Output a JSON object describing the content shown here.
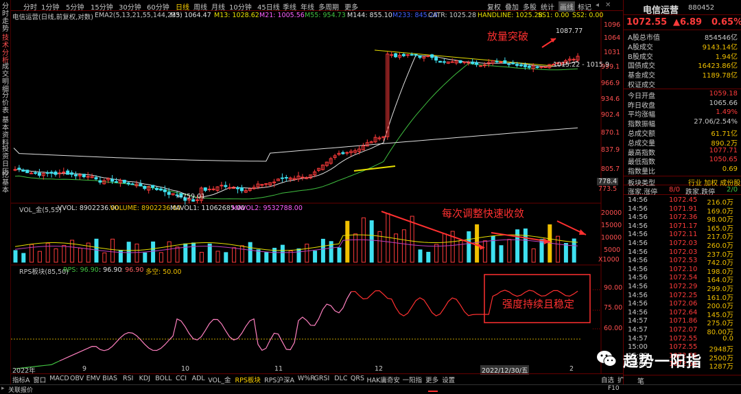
{
  "left_sidebar": [
    "分时走势",
    "技术分析",
    "成交明细",
    "分价表",
    "基本资料",
    "投资日历",
    "挖基本"
  ],
  "topbar": {
    "periods": [
      "分时",
      "1分钟",
      "5分钟",
      "15分钟",
      "30分钟",
      "60分钟",
      "日线",
      "周线",
      "月线",
      "10分钟",
      "45日线",
      "季线",
      "年线",
      "多周期",
      "更多"
    ],
    "active": "日线",
    "tools": [
      "复权",
      "叠加",
      "多股",
      "统计",
      "画线",
      "标记"
    ]
  },
  "kline_info": {
    "name": "电信运营(日线,前复权,对数)",
    "ema": "EMA2(5,13,21,55,144,233)",
    "m5": "M5: 1064.47",
    "m13": "M13: 1028.62",
    "m21": "M21: 1005.56",
    "m55": "M55: 954.73",
    "m144": "M144: 855.10",
    "m233": "M233: 845.28",
    "catr": "CATR: 1025.28",
    "handline": "HANDLINE: 1025.28",
    "ss1": "SS1: 0.00",
    "ss2": "SS2: 0.00"
  },
  "price_axis": [
    "1096",
    "1064",
    "1031",
    "999.1",
    "966.9",
    "934.6",
    "902.4",
    "870.1",
    "837.9",
    "805.7",
    "778.4",
    "773.5"
  ],
  "vol_info": {
    "name": "VOL_金(5,55)",
    "vvol": "VVOL: 8902236.00",
    "volume": "VOLUME: 8902236.00",
    "mavol1": "MAVOL1: 11062685.00",
    "mavol2": "MAVOL2: 9532788.00"
  },
  "vol_axis": [
    "20000",
    "15000",
    "10000",
    "5000",
    "X1000"
  ],
  "rps_info": {
    "name": "RPS板块(85,50)",
    "rps": "RPS: 96.90",
    "v2": ": 96.90",
    "v3": ": 96.90",
    "dk": "多空: 50.00"
  },
  "rps_axis": [
    "90.00",
    "75.00",
    "60.00"
  ],
  "x_axis": [
    "2022年",
    "9",
    "10",
    "11",
    "12",
    "2022/12/30/五",
    "2"
  ],
  "chart_labels": {
    "high": "1087.77",
    "low": "←759.01",
    "seg": "1015.22 - 1015.9"
  },
  "annotations": {
    "breakout": "放量突破",
    "converge": "每次调整快速收敛",
    "strength": "强度持续且稳定"
  },
  "rpanel": {
    "title": "电信运营",
    "code": "880452",
    "price": "1072.55",
    "change": "▲6.89",
    "pct": "0.65%",
    "rows": [
      [
        "A股总市值",
        "854546亿"
      ],
      [
        "A股成交",
        "9143.14亿"
      ],
      [
        "B股成交",
        "1.94亿"
      ],
      [
        "国债成交",
        "16423.86亿"
      ],
      [
        "基金成交",
        "1189.78亿"
      ],
      [
        "权证成交",
        ""
      ],
      [
        "今日开盘",
        "1059.18"
      ],
      [
        "昨日收盘",
        "1065.66"
      ],
      [
        "平均涨幅",
        "1.49%"
      ],
      [
        "指数振幅",
        "27.06/2.54%"
      ],
      [
        "总成交额",
        "61.71亿"
      ],
      [
        "总成交量",
        "890.2万"
      ],
      [
        "最高指数",
        "1077.71"
      ],
      [
        "最低指数",
        "1050.65"
      ],
      [
        "指数量比",
        "0.69"
      ]
    ],
    "sector_type": "板块类型",
    "sector_tags": "行业 加权 成份股",
    "zhangjia": "涨家.涨停",
    "zj_val": "8/0",
    "diejia": "跌家.跌停",
    "dj_val": "2/0",
    "ticks": [
      [
        "14:56",
        "1072.45",
        "216.0万"
      ],
      [
        "14:56",
        "1071.91",
        "169.0万"
      ],
      [
        "14:56",
        "1072.36",
        "98.00万"
      ],
      [
        "14:56",
        "1071.17",
        "165.0万"
      ],
      [
        "14:56",
        "1072.11",
        "217.0万"
      ],
      [
        "14:56",
        "1072.03",
        "260.0万"
      ],
      [
        "14:56",
        "1072.03",
        "237.0万"
      ],
      [
        "14:56",
        "1072.53",
        "742.0万"
      ],
      [
        "14:56",
        "1072.10",
        "198.0万"
      ],
      [
        "14:56",
        "1072.54",
        "164.0万"
      ],
      [
        "14:56",
        "1072.29",
        "299.0万"
      ],
      [
        "14:56",
        "1072.25",
        "161.0万"
      ],
      [
        "14:56",
        "1072.06",
        "200.0万"
      ],
      [
        "14:56",
        "1072.64",
        "145.0万"
      ],
      [
        "14:57",
        "1071.86",
        "275.0万"
      ],
      [
        "14:57",
        "1072.07",
        "80.00万"
      ],
      [
        "14:57",
        "1072.55",
        "0.0"
      ],
      [
        "15:00",
        "1072.55",
        "2948万"
      ],
      [
        "15:00",
        "1072.55",
        "2500万"
      ],
      [
        "15:00",
        "1072.55",
        "1287万"
      ]
    ]
  },
  "bottom_tabs": [
    "指标A",
    "窗口",
    "MACD",
    "OBV",
    "EMV",
    "BIAS",
    "RSI",
    "KDJ",
    "BOLL",
    "CCI",
    "ADL",
    "VOL_金",
    "RPS板块",
    "RPS沪深A",
    "W%R",
    "GRSI",
    "DLC",
    "QRS",
    "HAK庸奇安",
    "一阳指",
    "更多",
    "设置"
  ],
  "right_tab": "自选",
  "right_tab2": "扩",
  "status_left": "关联报价",
  "status_f10": "F10",
  "status_b": "笔",
  "watermark": "趋势一阳指",
  "colors": {
    "up": "#ff3b3b",
    "down": "#3fe0f0",
    "gold": "#f0c000",
    "yellow": "#e8e000",
    "white": "#e0e0e0",
    "green": "#40c040",
    "purple": "#c040c0"
  }
}
